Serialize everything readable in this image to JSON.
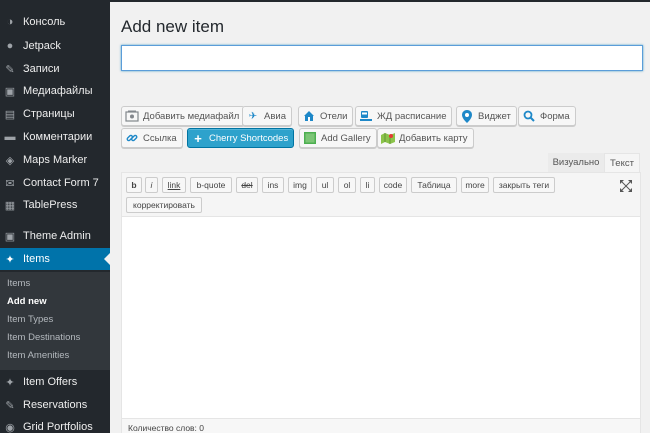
{
  "sidebar": {
    "items": [
      {
        "label": "Консоль",
        "icon": "dashboard-icon",
        "glyph": "◑"
      },
      {
        "label": "Jetpack",
        "icon": "jetpack-icon",
        "glyph": "●"
      },
      {
        "label": "Записи",
        "icon": "pin-icon",
        "glyph": "✎"
      },
      {
        "label": "Медиафайлы",
        "icon": "media-icon",
        "glyph": "▣"
      },
      {
        "label": "Страницы",
        "icon": "pages-icon",
        "glyph": "▤"
      },
      {
        "label": "Комментарии",
        "icon": "comments-icon",
        "glyph": "▬"
      },
      {
        "label": "Maps Marker",
        "icon": "maps-icon",
        "glyph": "◈"
      },
      {
        "label": "Contact Form 7",
        "icon": "mail-icon",
        "glyph": "✉"
      },
      {
        "label": "TablePress",
        "icon": "table-icon",
        "glyph": "▦"
      },
      {
        "label": "Theme Admin",
        "icon": "theme-icon",
        "glyph": "▣"
      },
      {
        "label": "Items",
        "icon": "items-icon",
        "glyph": "✦"
      },
      {
        "label": "Item Offers",
        "icon": "offers-icon",
        "glyph": "✦"
      },
      {
        "label": "Reservations",
        "icon": "reservations-icon",
        "glyph": "✎"
      },
      {
        "label": "Grid Portfolios",
        "icon": "grid-icon",
        "glyph": "◉"
      }
    ],
    "submenu": [
      "Items",
      "Add new",
      "Item Types",
      "Item Destinations",
      "Item Amenities"
    ]
  },
  "main": {
    "title": "Add new item",
    "title_value": ""
  },
  "media_buttons": {
    "add_media": "Добавить медиафайл",
    "avia": "Авиа",
    "hotels": "Отели",
    "rail": "ЖД расписание",
    "widget": "Виджет",
    "form": "Форма",
    "link": "Ссылка",
    "cherry": "Cherry Shortcodes",
    "gallery": "Add Gallery",
    "map": "Добавить карту"
  },
  "tabs": {
    "visual": "Визуально",
    "text": "Текст"
  },
  "quicktags": {
    "row1": [
      "b",
      "i",
      "link",
      "b-quote",
      "del",
      "ins",
      "img",
      "ul",
      "ol",
      "li",
      "code",
      "Таблица",
      "more",
      "закрыть теги"
    ],
    "row2": [
      "корректировать"
    ]
  },
  "status": {
    "word_count": "Количество слов: 0"
  },
  "colors": {
    "sidebar_bg": "#23282d",
    "active": "#0073aa",
    "primary_button": "#2ea2cc"
  }
}
